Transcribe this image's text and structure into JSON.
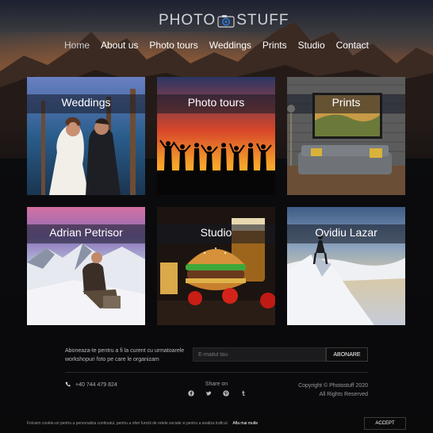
{
  "header": {
    "logo_left": "PHOTO",
    "logo_right": "STUFF",
    "nav": [
      {
        "label": "Home",
        "active": true
      },
      {
        "label": "About us"
      },
      {
        "label": "Photo tours"
      },
      {
        "label": "Weddings"
      },
      {
        "label": "Prints"
      },
      {
        "label": "Studio"
      },
      {
        "label": "Contact"
      }
    ]
  },
  "tiles": [
    {
      "label": "Weddings"
    },
    {
      "label": "Photo tours"
    },
    {
      "label": "Prints"
    },
    {
      "label": "Adrian Petrisor"
    },
    {
      "label": "Studio"
    },
    {
      "label": "Ovidiu Lazar"
    }
  ],
  "footer": {
    "newsletter_text": "Aboneaza-te pentru a fi la curent cu urmatoarele workshopuri foto pe care le organizam",
    "email_placeholder": "E-mailul tau",
    "subscribe_label": "ABONARE",
    "phone": "+40 744 479 824",
    "share_label": "Share on",
    "social_icons": [
      "facebook-icon",
      "twitter-icon",
      "pinterest-icon",
      "tumblr-icon"
    ],
    "copyright_line1": "Copyright © Photostuff 2020",
    "copyright_line2": "All Rights Reserved"
  },
  "cookie": {
    "text": "Folosim cookie-uri pentru a personaliza continutul, pentru a oferi functii de retele sociale si pentru a analiza traficul.",
    "link": "Afla mai multe",
    "accept": "ACCEPT"
  },
  "colors": {
    "background": "#0b0c10",
    "accent_blue": "#2a7bd8",
    "text_muted": "#b9b9b9"
  }
}
